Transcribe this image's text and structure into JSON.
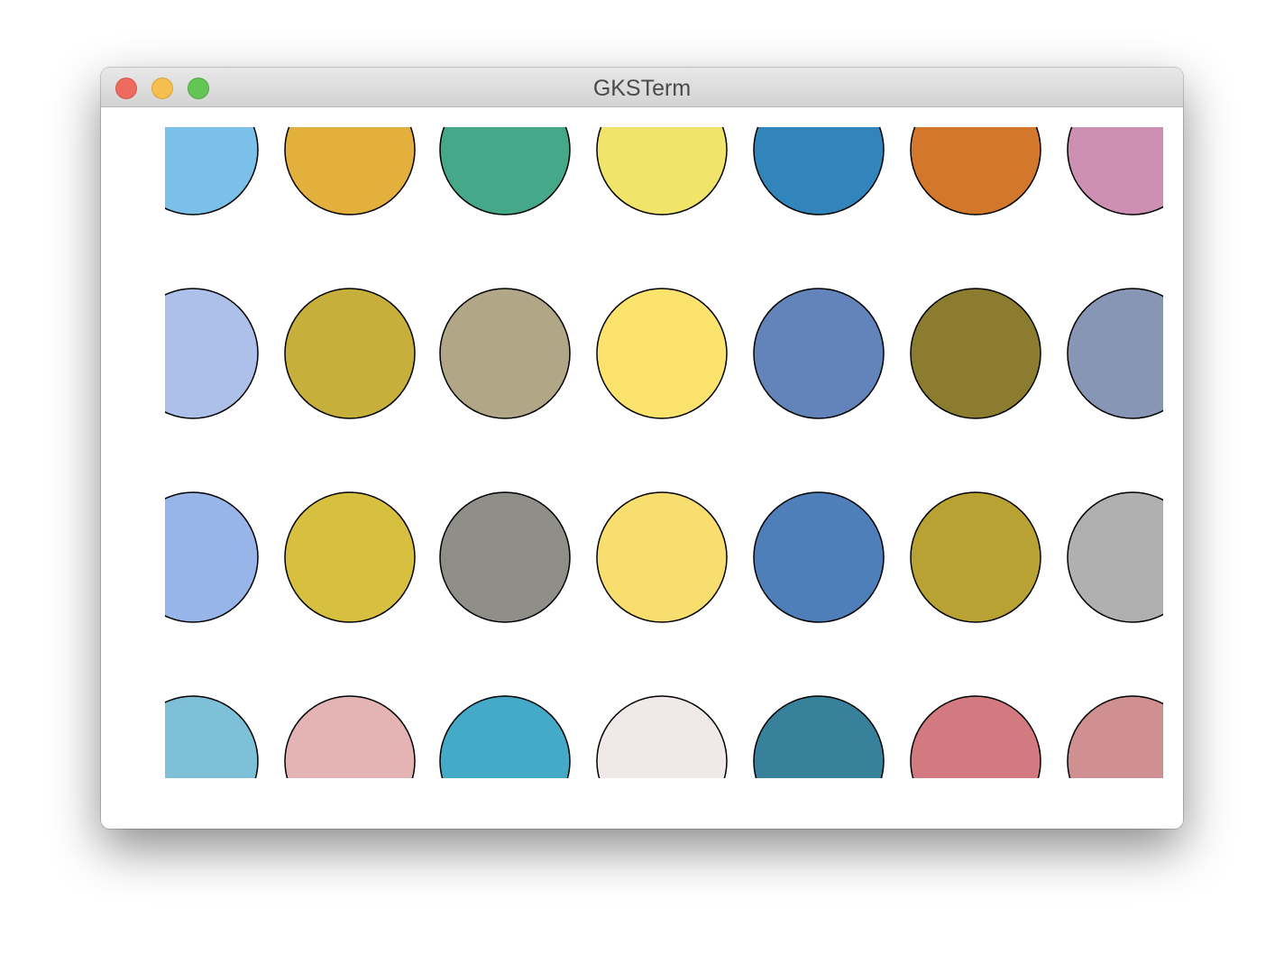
{
  "window": {
    "title": "GKSTerm",
    "buttons": [
      {
        "name": "close",
        "color": "#ed6a5e",
        "border": "#d5574b"
      },
      {
        "name": "minimize",
        "color": "#f5bf4f",
        "border": "#d9a43b"
      },
      {
        "name": "zoom",
        "color": "#62c554",
        "border": "#4ea841"
      }
    ]
  },
  "plot": {
    "background": "#ffffff",
    "outline_color": "#000000",
    "rows": [
      [
        "#7bc0e8",
        "#e3af3d",
        "#45a888",
        "#f0e46a",
        "#3285bb",
        "#d3772c",
        "#cd8fb2"
      ],
      [
        "#acc0ea",
        "#c6b03b",
        "#b1a787",
        "#fbe36e",
        "#6284ba",
        "#8c7c30",
        "#8796b4"
      ],
      [
        "#98b5e9",
        "#d7bf3f",
        "#8f8e88",
        "#f8de6f",
        "#4f7fb9",
        "#b8a233",
        "#b0b0b1"
      ],
      [
        "#7ec0d7",
        "#e4b3b4",
        "#45aac8",
        "#efe9e8",
        "#37829a",
        "#d37a80",
        "#d09091"
      ]
    ]
  }
}
